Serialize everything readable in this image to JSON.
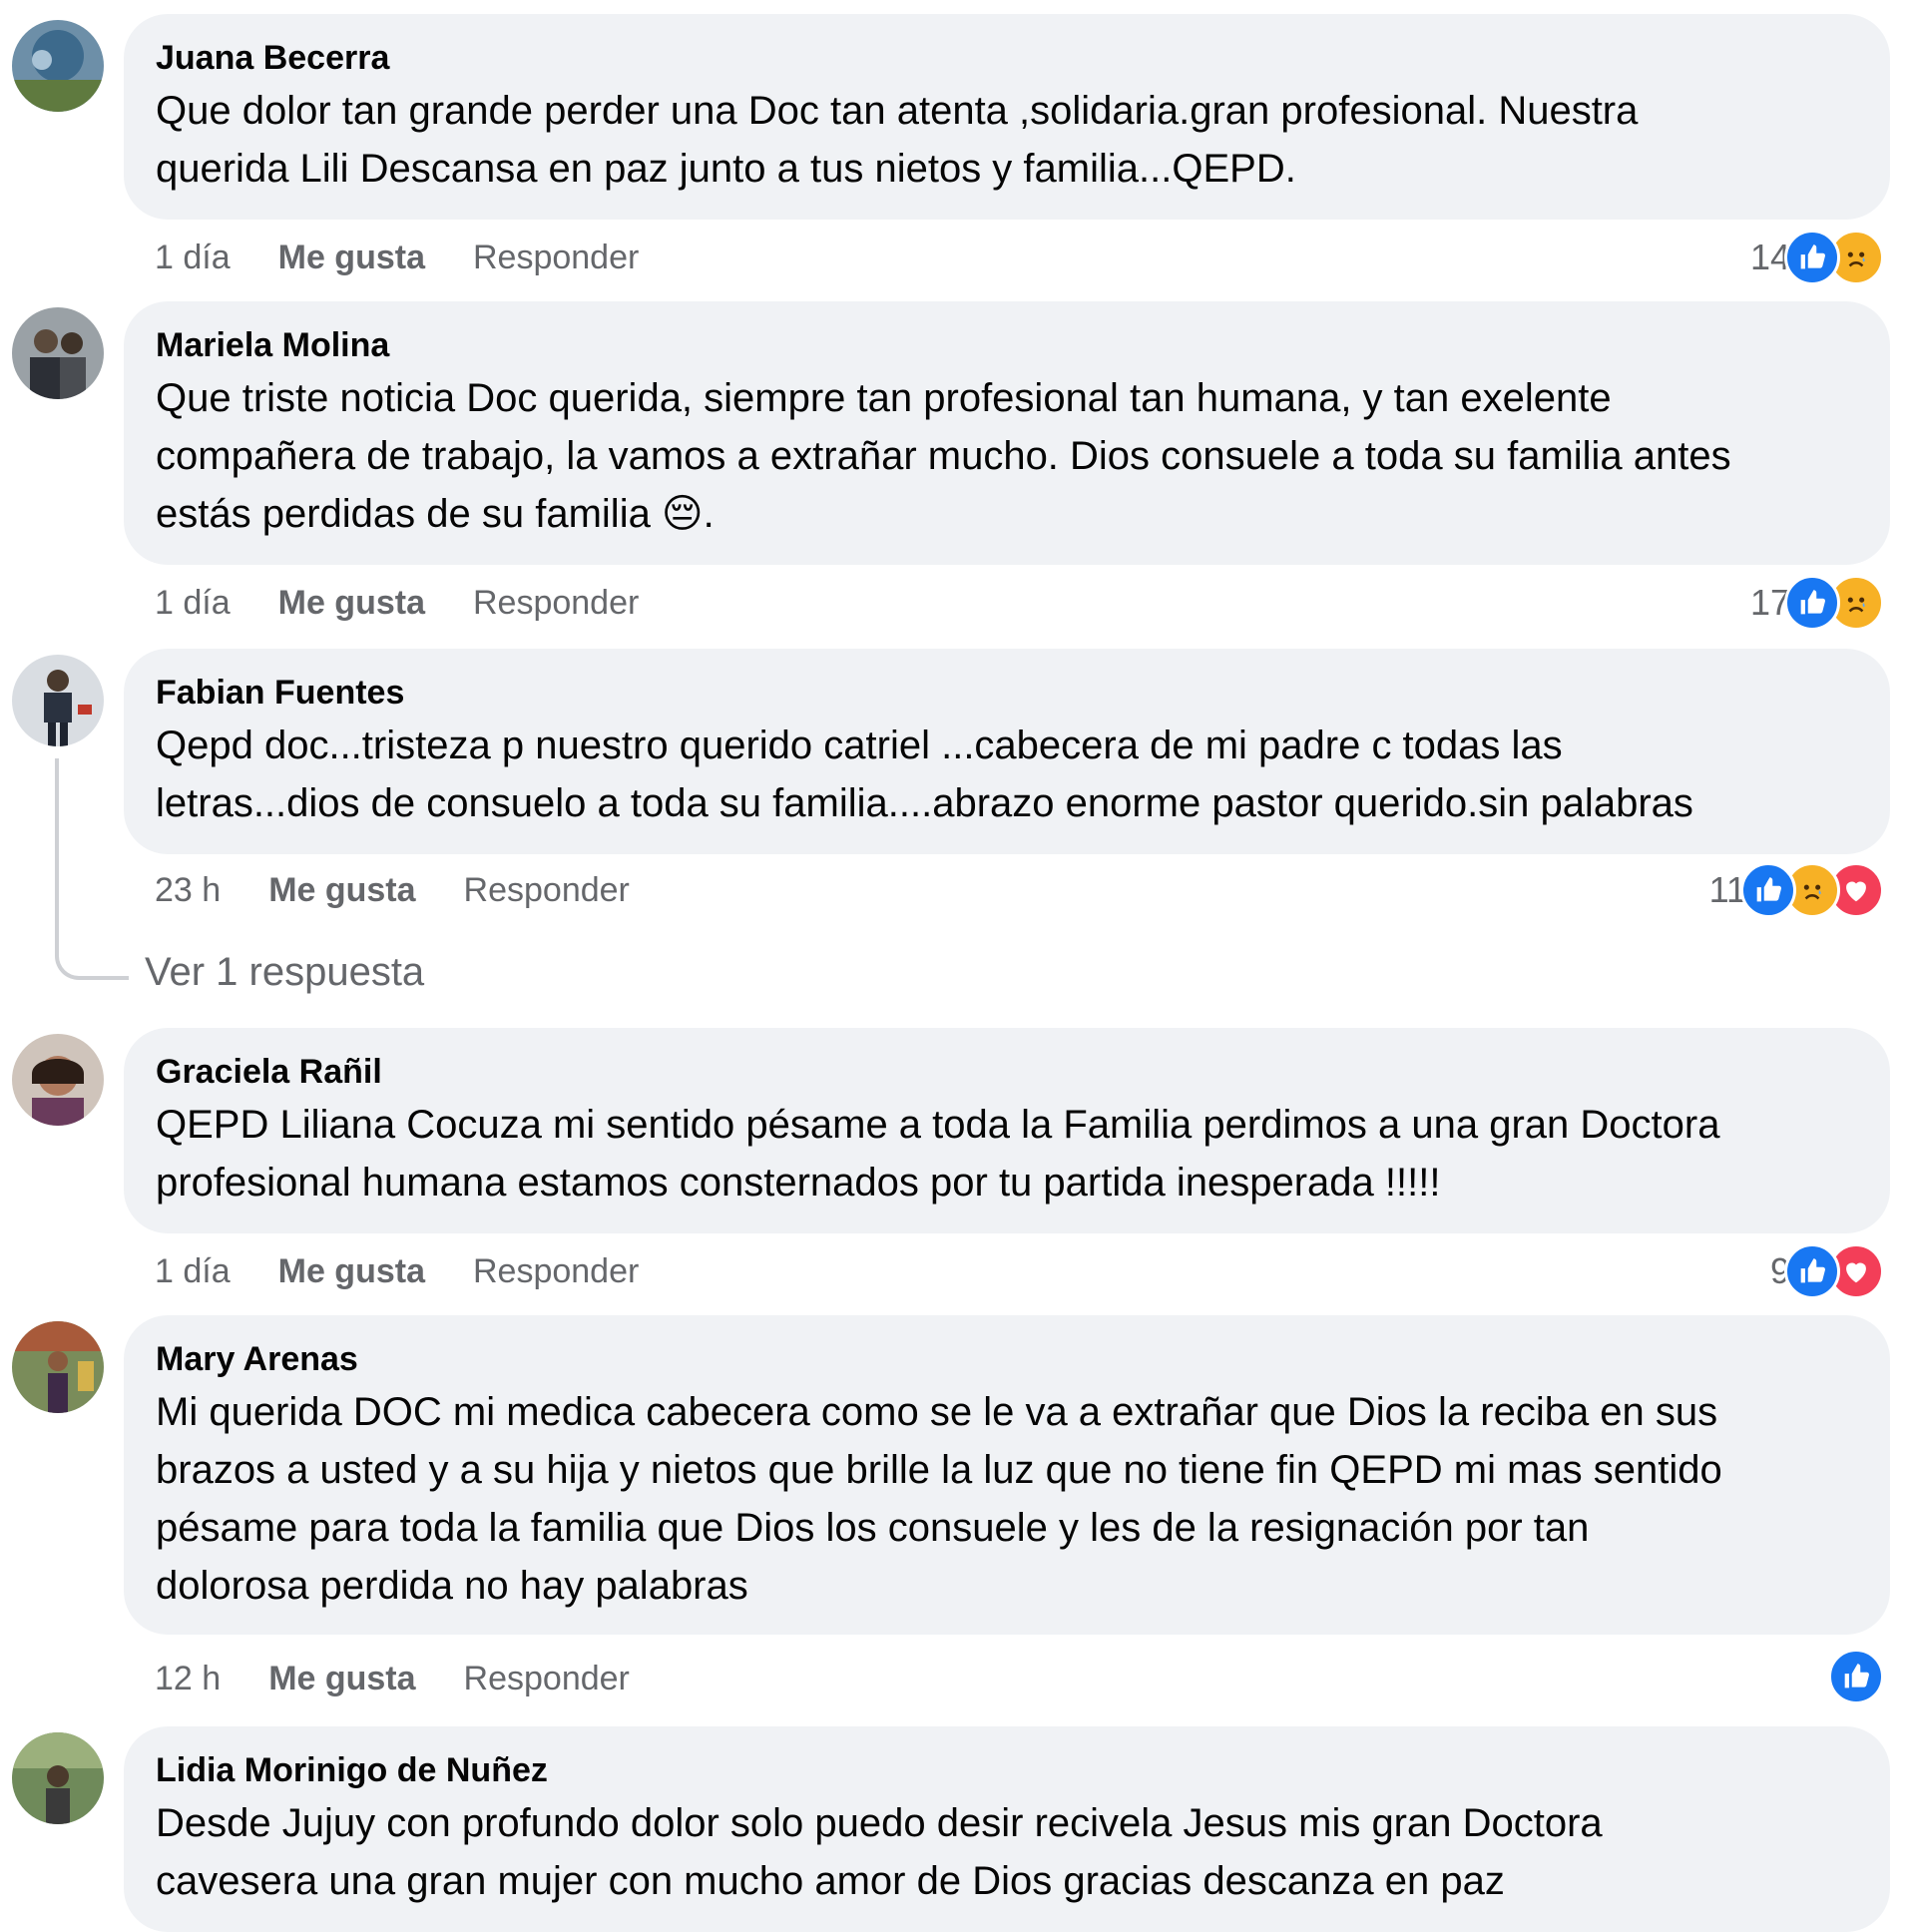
{
  "comments": [
    {
      "author": "Juana Becerra",
      "lines": [
        "Que dolor tan grande perder una Doc tan atenta ,solidaria.gran profesional. Nuestra",
        "querida Lili Descansa en paz junto a tus nietos y familia...QEPD."
      ],
      "time": "1 día",
      "like_label": "Me gusta",
      "reply_label": "Responder",
      "reaction_count": "14",
      "reactions": [
        "like-icon",
        "sad-icon"
      ]
    },
    {
      "author": "Mariela Molina",
      "lines": [
        "Que triste noticia Doc querida, siempre tan profesional tan humana, y tan exelente",
        "compañera de trabajo, la vamos a extrañar mucho. Dios consuele a toda su familia antes",
        "estás perdidas de su familia 😔."
      ],
      "time": "1 día",
      "like_label": "Me gusta",
      "reply_label": "Responder",
      "reaction_count": "17",
      "reactions": [
        "like-icon",
        "sad-icon"
      ]
    },
    {
      "author": "Fabian Fuentes",
      "lines": [
        "Qepd doc...tristeza p nuestro querido catriel ...cabecera de mi padre c todas las",
        "letras...dios de consuelo a toda su familia....abrazo enorme pastor querido.sin palabras"
      ],
      "time": "23 h",
      "like_label": "Me gusta",
      "reply_label": "Responder",
      "reaction_count": "11",
      "reactions": [
        "like-icon",
        "sad-icon",
        "love-icon"
      ],
      "view_replies": "Ver 1 respuesta"
    },
    {
      "author": "Graciela Rañil",
      "lines": [
        "QEPD Liliana Cocuza mi sentido pésame a toda la Familia perdimos a una gran Doctora",
        "profesional humana estamos consternados por tu partida inesperada !!!!!"
      ],
      "time": "1 día",
      "like_label": "Me gusta",
      "reply_label": "Responder",
      "reaction_count": "9",
      "reactions": [
        "like-icon",
        "love-icon"
      ]
    },
    {
      "author": "Mary Arenas",
      "lines": [
        "Mi querida DOC mi medica cabecera como se le va a extrañar que Dios la reciba en sus",
        "brazos a usted y a su hija y nietos que brille la luz que no tiene fin QEPD mi mas sentido",
        "pésame para toda la familia que Dios los consuele y les de la resignación por tan",
        "dolorosa perdida no hay palabras"
      ],
      "time": "12 h",
      "like_label": "Me gusta",
      "reply_label": "Responder",
      "reaction_count": "",
      "reactions": [
        "like-icon"
      ]
    },
    {
      "author": "Lidia Morinigo de Nuñez",
      "lines": [
        "Desde Jujuy con profundo dolor solo puedo desir recivela Jesus mis gran Doctora",
        "cavesera una gran mujer con mucho amor de Dios gracias descanza en paz"
      ]
    }
  ],
  "colors": {
    "bubble": "#f0f2f5",
    "secondary_text": "#65676b",
    "like_blue": "#1877f2",
    "love_red": "#f33e58",
    "sad_yellow": "#f7b125"
  }
}
